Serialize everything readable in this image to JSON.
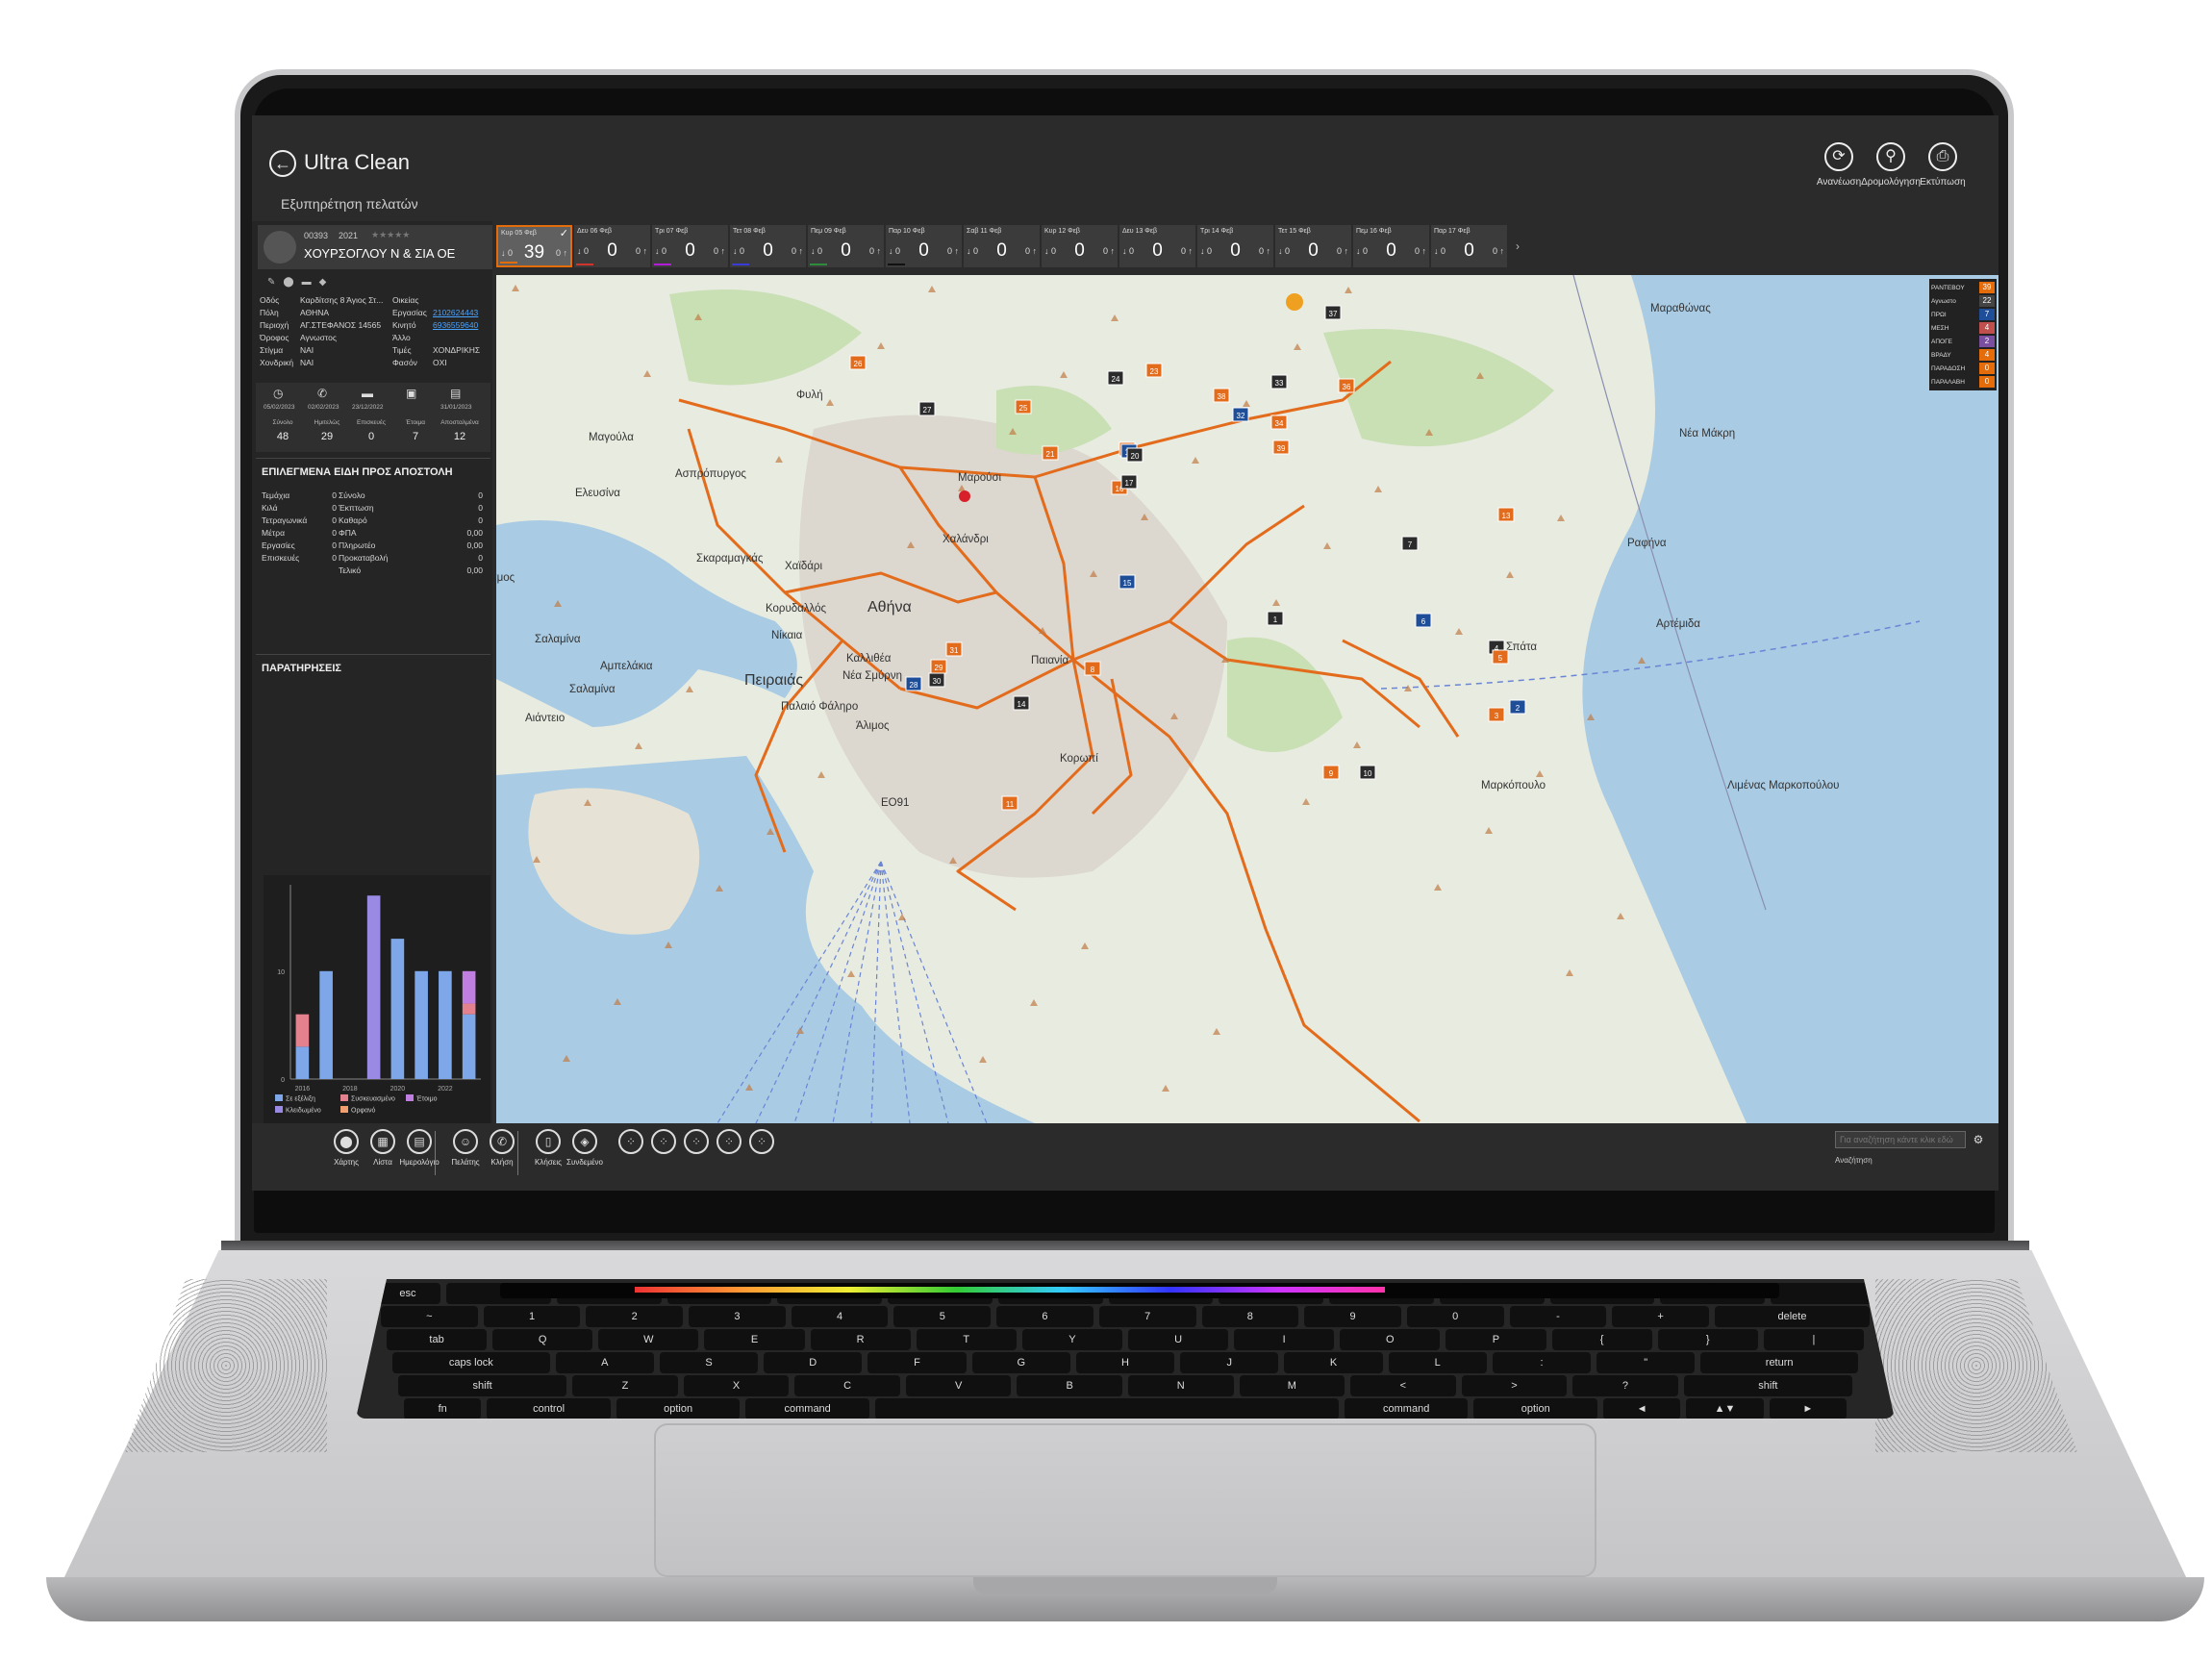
{
  "app": {
    "title": "Ultra Clean",
    "subtitle": "Εξυπηρέτηση πελατών"
  },
  "toolbar": [
    {
      "label": "Ανανέωση",
      "icon": "refresh-icon",
      "glyph": "⟳"
    },
    {
      "label": "Δρομολόγηση",
      "icon": "route-icon",
      "glyph": "⚲"
    },
    {
      "label": "Εκτύπωση",
      "icon": "printer-icon",
      "glyph": "⎙"
    }
  ],
  "customer": {
    "code": "00393",
    "year": "2021",
    "rating": "★★★★★",
    "name": "ΧΟΥΡΣΟΓΛΟΥ Ν & ΣΙΑ ΟΕ",
    "details_left": [
      [
        "Οδός",
        "Καρδίτσης 8 Άγιος Στ..."
      ],
      [
        "Πόλη",
        "ΑΘΗΝΑ"
      ],
      [
        "Περιοχή",
        "ΑΓ.ΣΤΕΦΑΝΟΣ 14565"
      ],
      [
        "Όροφος",
        "Αγνωστος"
      ],
      [
        "Στίγμα",
        "ΝΑΙ"
      ],
      [
        "Χονδρική",
        "ΝΑΙ"
      ]
    ],
    "details_right": [
      [
        "Οικείας",
        ""
      ],
      [
        "Εργασίας",
        "2102624443"
      ],
      [
        "Κινητό",
        "6936559640"
      ],
      [
        "Άλλο",
        ""
      ],
      [
        "Τιμές",
        "ΧΟΝΔΡΙΚΗΣ"
      ],
      [
        "Φασόν",
        "ΟΧΙ"
      ]
    ],
    "history_dates": [
      "05/02/2023",
      "02/02/2023",
      "23/12/2022",
      "",
      "31/01/2023"
    ],
    "counters": [
      {
        "label": "Σύνολο",
        "value": "48"
      },
      {
        "label": "Ημιτελώς",
        "value": "29"
      },
      {
        "label": "Επισκευές",
        "value": "0"
      },
      {
        "label": "Έτοιμα",
        "value": "7"
      },
      {
        "label": "Αποσταλμένα",
        "value": "12"
      }
    ]
  },
  "selected_items": {
    "title": "ΕΠΙΛΕΓΜΕΝΑ ΕΙΔΗ ΠΡΟΣ ΑΠΟΣΤΟΛΗ",
    "left": [
      [
        "Τεμάχια",
        "0"
      ],
      [
        "Κιλά",
        "0"
      ],
      [
        "Τετραγωνικά",
        "0"
      ],
      [
        "Μέτρα",
        "0"
      ],
      [
        "",
        ""
      ],
      [
        "Εργασίες",
        "0"
      ],
      [
        "Επισκευές",
        "0"
      ]
    ],
    "right": [
      [
        "Σύνολο",
        "0"
      ],
      [
        "Έκπτωση",
        "0"
      ],
      [
        "Καθαρό",
        "0"
      ],
      [
        "ΦΠΑ",
        "0,00"
      ],
      [
        "Πληρωτέο",
        "0,00"
      ],
      [
        "Προκαταβολή",
        "0"
      ],
      [
        "Τελικό",
        "0,00"
      ]
    ]
  },
  "notes": {
    "title": "ΠΑΡΑΤΗΡΗΣΕΙΣ"
  },
  "days": [
    {
      "label": "Κυρ 05 Φεβ",
      "value": "39",
      "in": "0",
      "out": "0",
      "selected": true,
      "color": "#e46c0a"
    },
    {
      "label": "Δευ 06 Φεβ",
      "value": "0",
      "in": "0",
      "out": "0",
      "selected": false,
      "color": "#d0342c"
    },
    {
      "label": "Τρι 07 Φεβ",
      "value": "0",
      "in": "0",
      "out": "0",
      "selected": false,
      "color": "#b21cd6"
    },
    {
      "label": "Τετ 08 Φεβ",
      "value": "0",
      "in": "0",
      "out": "0",
      "selected": false,
      "color": "#3a3ad6"
    },
    {
      "label": "Πεμ 09 Φεβ",
      "value": "0",
      "in": "0",
      "out": "0",
      "selected": false,
      "color": "#2e8b3c"
    },
    {
      "label": "Παρ 10 Φεβ",
      "value": "0",
      "in": "0",
      "out": "0",
      "selected": false,
      "color": "#111111"
    },
    {
      "label": "Σαβ 11 Φεβ",
      "value": "0",
      "in": "0",
      "out": "0",
      "selected": false,
      "color": ""
    },
    {
      "label": "Κυρ 12 Φεβ",
      "value": "0",
      "in": "0",
      "out": "0",
      "selected": false,
      "color": ""
    },
    {
      "label": "Δευ 13 Φεβ",
      "value": "0",
      "in": "0",
      "out": "0",
      "selected": false,
      "color": ""
    },
    {
      "label": "Τρι 14 Φεβ",
      "value": "0",
      "in": "0",
      "out": "0",
      "selected": false,
      "color": ""
    },
    {
      "label": "Τετ 15 Φεβ",
      "value": "0",
      "in": "0",
      "out": "0",
      "selected": false,
      "color": ""
    },
    {
      "label": "Πεμ 16 Φεβ",
      "value": "0",
      "in": "0",
      "out": "0",
      "selected": false,
      "color": ""
    },
    {
      "label": "Παρ 17 Φεβ",
      "value": "0",
      "in": "0",
      "out": "0",
      "selected": false,
      "color": ""
    }
  ],
  "map": {
    "places": [
      "Μαραθώνας",
      "Φυλή",
      "Μαγούλα",
      "Νέα Μάκρη",
      "Ασπρόπυργος",
      "Μαρούσι",
      "Ελευσίνα",
      "Χαλάνδρι",
      "Ραφήνα",
      "Σκαραμαγκάς",
      "Χαϊδάρι",
      "Αθήνα",
      "Κορυδαλλός",
      "Νίκαια",
      "Αρτέμιδα",
      "Σαλαμίνα",
      "Σπάτα",
      "Αμπελάκια",
      "Καλλιθέα",
      "Παιανία",
      "Πειραιάς",
      "Νέα Σμύρνη",
      "Σαλαμίνα",
      "Αιάντειο",
      "Παλαιό Φάληρο",
      "Άλιμος",
      "Κορωπί",
      "Μαρκόπουλο",
      "Λιμένας Μαρκοπούλου",
      "ΕΟ91",
      "αμος"
    ],
    "stats": [
      {
        "label": "ΡΑΝΤΕΒΟΥ",
        "value": "39",
        "color": "#e46c0a"
      },
      {
        "label": "Αγνωστο",
        "value": "22",
        "color": "#444444"
      },
      {
        "label": "ΠΡΩΙ",
        "value": "7",
        "color": "#1f4e99"
      },
      {
        "label": "ΜΕΣΗ",
        "value": "4",
        "color": "#c0504d"
      },
      {
        "label": "ΑΠΟΓΕ",
        "value": "2",
        "color": "#7a4fa0"
      },
      {
        "label": "ΒΡΑΔΥ",
        "value": "4",
        "color": "#e46c0a"
      },
      {
        "label": "ΠΑΡΑΔΟΣΗ",
        "value": "0",
        "color": "#e46c0a"
      },
      {
        "label": "ΠΑΡΑΛΑΒΗ",
        "value": "0",
        "color": "#e46c0a"
      }
    ],
    "markers": [
      "1",
      "2",
      "3",
      "4",
      "5",
      "6",
      "7",
      "8",
      "9",
      "10",
      "11",
      "13",
      "14",
      "15",
      "16",
      "17",
      "18",
      "19",
      "20",
      "21",
      "23",
      "24",
      "25",
      "26",
      "27",
      "28",
      "29",
      "30",
      "31",
      "32",
      "33",
      "34",
      "36",
      "37",
      "38",
      "39"
    ]
  },
  "chart_data": {
    "type": "bar",
    "categories": [
      "2016",
      "2017",
      "2018",
      "2019",
      "2020",
      "2021",
      "2022",
      "2023"
    ],
    "tick_labels": [
      "2016",
      "2018",
      "2020",
      "2022"
    ],
    "y_ticks": [
      "0",
      "10"
    ],
    "ylim": [
      0,
      18
    ],
    "series": [
      {
        "name": "Σε εξέλιξη",
        "color": "#7da7e8",
        "values": [
          3,
          10,
          0,
          0,
          13,
          10,
          10,
          6
        ]
      },
      {
        "name": "Συσκευασμένο",
        "color": "#e4818e",
        "values": [
          3,
          0,
          0,
          0,
          0,
          0,
          0,
          1
        ]
      },
      {
        "name": "Έτοιμο",
        "color": "#c07ee0",
        "values": [
          0,
          0,
          0,
          0,
          0,
          0,
          0,
          3
        ]
      },
      {
        "name": "Κλειδωμένο",
        "color": "#9a8ae3",
        "values": [
          0,
          0,
          0,
          17,
          0,
          0,
          0,
          0
        ]
      },
      {
        "name": "Ορφανό",
        "color": "#f0a070",
        "values": [
          0,
          0,
          0,
          0,
          0,
          0,
          0,
          0
        ]
      }
    ]
  },
  "bottom_buttons": [
    {
      "label": "Χάρτης",
      "icon": "map-pin-icon",
      "glyph": "⬤"
    },
    {
      "label": "Λίστα",
      "icon": "list-icon",
      "glyph": "▦"
    },
    {
      "label": "Ημερολόγιο",
      "icon": "calendar-icon",
      "glyph": "▤"
    },
    {
      "label": "Πελάτης",
      "icon": "customer-icon",
      "glyph": "☺"
    },
    {
      "label": "Κλήση",
      "icon": "phone-icon",
      "glyph": "✆"
    },
    {
      "label": "Κλήσεις",
      "icon": "mobile-icon",
      "glyph": "▯"
    },
    {
      "label": "Συνδεμένο",
      "icon": "compass-icon",
      "glyph": "◈"
    },
    {
      "label": "",
      "icon": "slot-icon",
      "glyph": "⁘"
    },
    {
      "label": "",
      "icon": "slot-icon",
      "glyph": "⁘"
    },
    {
      "label": "",
      "icon": "slot-icon",
      "glyph": "⁘"
    },
    {
      "label": "",
      "icon": "slot-icon",
      "glyph": "⁘"
    },
    {
      "label": "",
      "icon": "slot-icon",
      "glyph": "⁘"
    }
  ],
  "search": {
    "placeholder": "Για αναζήτηση κάντε κλικ εδώ",
    "label": "Αναζήτηση"
  },
  "keyboard": {
    "rows": [
      [
        "esc",
        "",
        "",
        "",
        "",
        "",
        "",
        "",
        "",
        "",
        "",
        "",
        "",
        ""
      ],
      [
        "~",
        "1",
        "2",
        "3",
        "4",
        "5",
        "6",
        "7",
        "8",
        "9",
        "0",
        "-",
        "+",
        "delete"
      ],
      [
        "tab",
        "Q",
        "W",
        "E",
        "R",
        "T",
        "Y",
        "U",
        "I",
        "O",
        "P",
        "{",
        "}",
        "|"
      ],
      [
        "caps lock",
        "A",
        "S",
        "D",
        "F",
        "G",
        "H",
        "J",
        "K",
        "L",
        ":",
        "\"",
        "return"
      ],
      [
        "shift",
        "Z",
        "X",
        "C",
        "V",
        "B",
        "N",
        "M",
        "<",
        ">",
        "?",
        "shift"
      ],
      [
        "fn",
        "control",
        "option",
        "command",
        "",
        "command",
        "option",
        "◄",
        "▲▼",
        "►"
      ]
    ]
  }
}
